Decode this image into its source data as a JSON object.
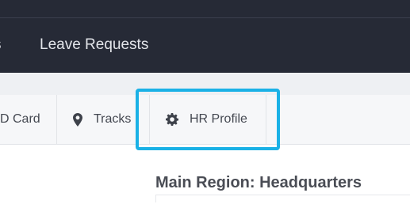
{
  "topnav": {
    "items": [
      {
        "label": "s"
      },
      {
        "label": "Leave Requests"
      }
    ]
  },
  "tabs": [
    {
      "label": "D Card",
      "icon": "id-card-icon"
    },
    {
      "label": "Tracks",
      "icon": "map-pin-icon"
    },
    {
      "label": "HR Profile",
      "icon": "gear-icon"
    }
  ],
  "main": {
    "region_title": "Main Region: Headquarters"
  },
  "colors": {
    "nav_bg": "#262a36",
    "highlight": "#1ab1e6",
    "tab_bg": "#f6f7f9"
  }
}
